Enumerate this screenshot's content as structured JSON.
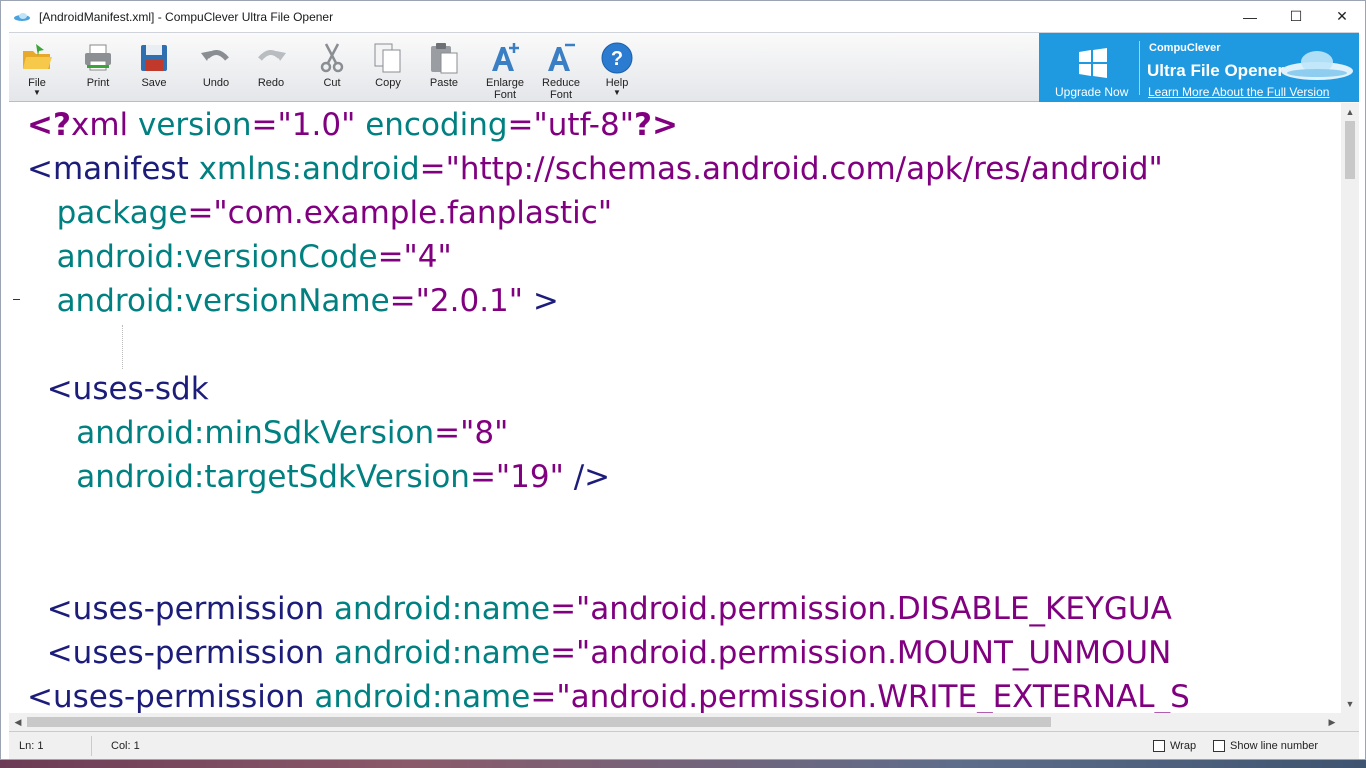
{
  "window": {
    "title": "[AndroidManifest.xml] - CompuClever Ultra File Opener"
  },
  "window_controls": {
    "minimize": "—",
    "maximize": "☐",
    "close": "✕"
  },
  "toolbar": {
    "file": "File",
    "print": "Print",
    "save": "Save",
    "undo": "Undo",
    "redo": "Redo",
    "cut": "Cut",
    "copy": "Copy",
    "paste": "Paste",
    "enlarge_1": "Enlarge",
    "enlarge_2": "Font",
    "reduce_1": "Reduce",
    "reduce_2": "Font",
    "help": "Help",
    "caret": "▼"
  },
  "promo": {
    "upgrade": "Upgrade Now",
    "brand": "CompuClever",
    "product": "Ultra File Opener",
    "link": "Learn More About the Full Version"
  },
  "editor": {
    "lines": [
      [
        {
          "t": "<?",
          "c": "t-pi"
        },
        {
          "t": "xml ",
          "c": "t-str"
        },
        {
          "t": "version",
          "c": "t-attr"
        },
        {
          "t": "=\"1.0\" ",
          "c": "t-str"
        },
        {
          "t": "encoding",
          "c": "t-attr"
        },
        {
          "t": "=\"utf-8\"",
          "c": "t-str"
        },
        {
          "t": "?>",
          "c": "t-pi"
        }
      ],
      [
        {
          "t": "<manifest ",
          "c": "t-tag"
        },
        {
          "t": "xmlns:android",
          "c": "t-attr"
        },
        {
          "t": "=\"http://schemas.android.com/apk/res/android\"",
          "c": "t-str"
        }
      ],
      [
        {
          "t": "   ",
          "c": "t-tag"
        },
        {
          "t": "package",
          "c": "t-attr"
        },
        {
          "t": "=\"com.example.fanplastic\"",
          "c": "t-str"
        }
      ],
      [
        {
          "t": "   ",
          "c": "t-tag"
        },
        {
          "t": "android:versionCode",
          "c": "t-attr"
        },
        {
          "t": "=\"4\"",
          "c": "t-str"
        }
      ],
      [
        {
          "t": "   ",
          "c": "t-tag"
        },
        {
          "t": "android:versionName",
          "c": "t-attr"
        },
        {
          "t": "=\"2.0.1\" ",
          "c": "t-str"
        },
        {
          "t": ">",
          "c": "t-tag"
        }
      ],
      [],
      [
        {
          "t": "  <uses-sdk",
          "c": "t-tag"
        }
      ],
      [
        {
          "t": "     ",
          "c": "t-tag"
        },
        {
          "t": "android:minSdkVersion",
          "c": "t-attr"
        },
        {
          "t": "=\"8\"",
          "c": "t-str"
        }
      ],
      [
        {
          "t": "     ",
          "c": "t-tag"
        },
        {
          "t": "android:targetSdkVersion",
          "c": "t-attr"
        },
        {
          "t": "=\"19\" ",
          "c": "t-str"
        },
        {
          "t": "/>",
          "c": "t-tag"
        }
      ],
      [],
      [],
      [
        {
          "t": "  <uses-permission ",
          "c": "t-tag"
        },
        {
          "t": "android:name",
          "c": "t-attr"
        },
        {
          "t": "=\"android.permission.DISABLE_KEYGUA",
          "c": "t-str"
        }
      ],
      [
        {
          "t": "  <uses-permission ",
          "c": "t-tag"
        },
        {
          "t": "android:name",
          "c": "t-attr"
        },
        {
          "t": "=\"android.permission.MOUNT_UNMOUN",
          "c": "t-str"
        }
      ],
      [
        {
          "t": "<uses-permission ",
          "c": "t-tag"
        },
        {
          "t": "android:name",
          "c": "t-attr"
        },
        {
          "t": "=\"android.permission.WRITE_EXTERNAL_S",
          "c": "t-str"
        }
      ]
    ]
  },
  "scroll": {
    "up": "▲",
    "down": "▼",
    "left": "◀",
    "right": "▶"
  },
  "status": {
    "line": "Ln: 1",
    "col": "Col: 1",
    "wrap": "Wrap",
    "show_line_number": "Show line number"
  },
  "colors": {
    "accent": "#1f9ae0",
    "tag": "#1c1c7a",
    "attribute": "#008080",
    "string": "#800080"
  }
}
